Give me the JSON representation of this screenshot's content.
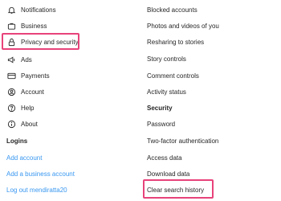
{
  "left_menu": {
    "items": [
      {
        "label": "Notifications",
        "icon": "bell-icon"
      },
      {
        "label": "Business",
        "icon": "briefcase-icon"
      },
      {
        "label": "Privacy and security",
        "icon": "lock-icon"
      },
      {
        "label": "Ads",
        "icon": "megaphone-icon"
      },
      {
        "label": "Payments",
        "icon": "credit-card-icon"
      },
      {
        "label": "Account",
        "icon": "account-circle-icon"
      },
      {
        "label": "Help",
        "icon": "help-circle-icon"
      },
      {
        "label": "About",
        "icon": "info-circle-icon"
      }
    ],
    "logins_header": "Logins",
    "add_account": "Add account",
    "add_business_account": "Add a business account",
    "log_out": "Log out mendiratta20"
  },
  "right_menu": {
    "items": [
      "Blocked accounts",
      "Photos and videos of you",
      "Resharing to stories",
      "Story controls",
      "Comment controls",
      "Activity status"
    ],
    "security_header": "Security",
    "security_items": [
      "Password",
      "Two-factor authentication",
      "Access data",
      "Download data",
      "Clear search history"
    ]
  },
  "colors": {
    "highlight": "#e8437a",
    "link": "#3897f0",
    "text": "#262626"
  }
}
